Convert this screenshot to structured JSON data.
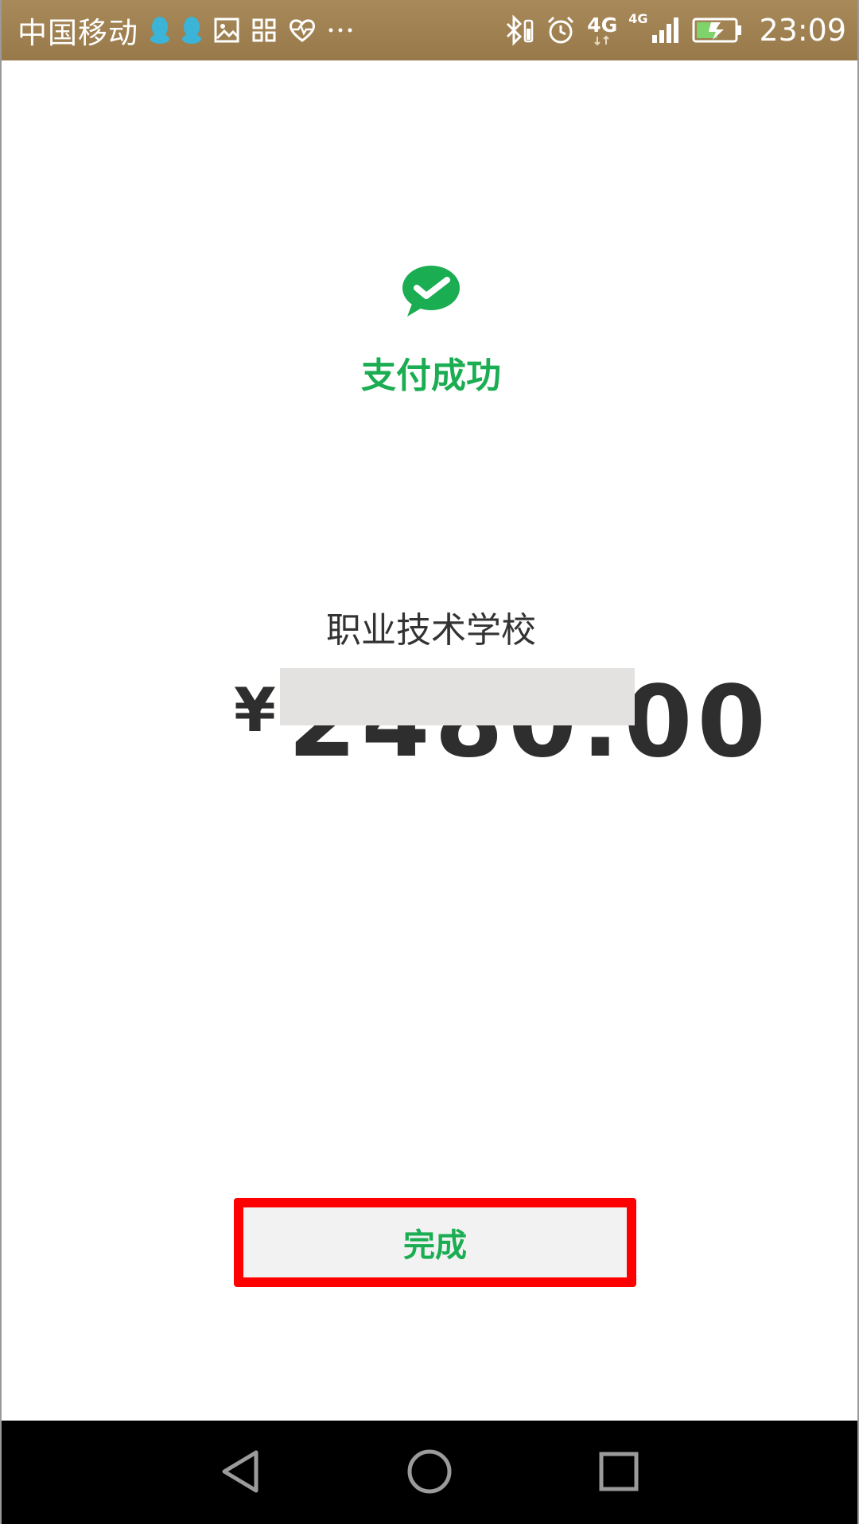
{
  "status_bar": {
    "carrier": "中国移动",
    "network_label": "4G",
    "network_label_small": "4G",
    "time": "23:09",
    "icons": [
      "qq-icon",
      "qq-icon",
      "gallery-icon",
      "apps-icon",
      "health-icon",
      "more-icon",
      "bluetooth-icon",
      "alarm-icon",
      "signal-icon",
      "battery-icon"
    ]
  },
  "payment": {
    "status": "支付成功",
    "merchant": "职业技术学校",
    "currency_symbol": "¥",
    "amount": "2480.00"
  },
  "actions": {
    "done_label": "完成"
  },
  "nav_bar": {
    "icons": [
      "back-icon",
      "home-icon",
      "recents-icon"
    ]
  },
  "colors": {
    "accent_green": "#1aad52",
    "status_bar_bg": "#a8895a",
    "highlight_red": "#ff0000",
    "button_bg": "#f2f2f2",
    "text_dark": "#333333"
  }
}
